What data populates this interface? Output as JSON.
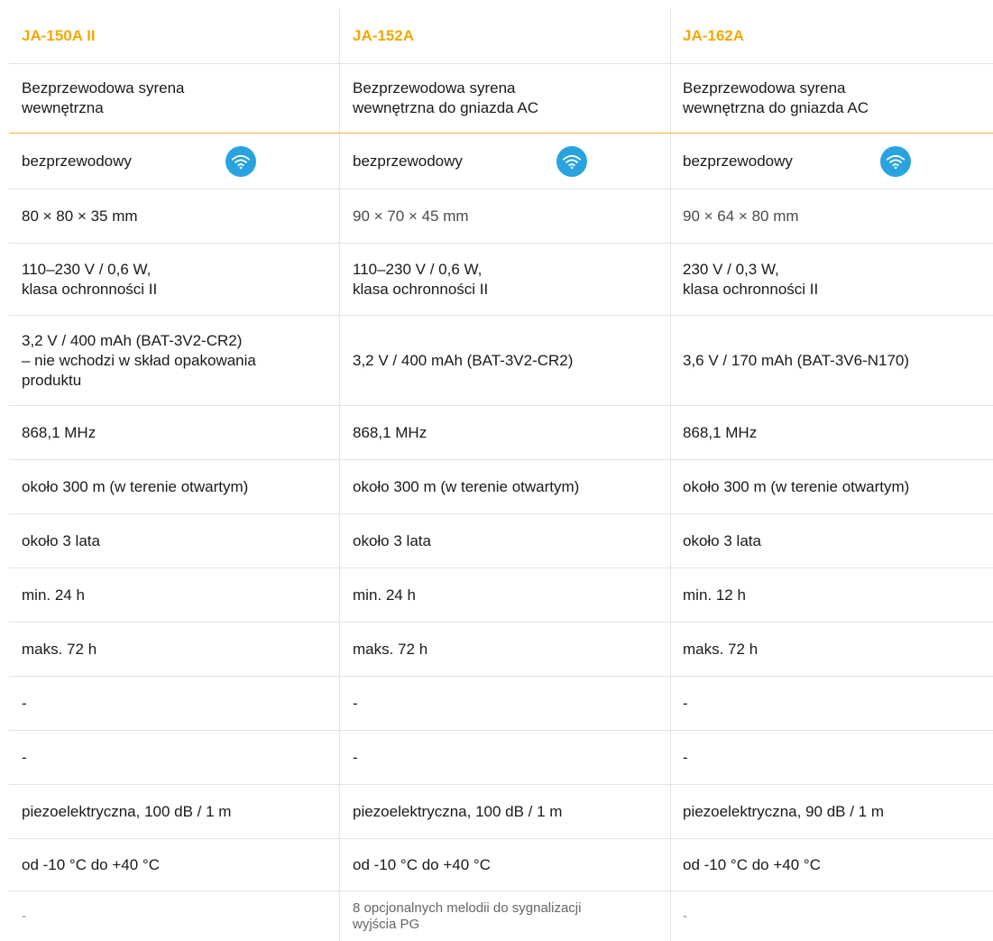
{
  "columns": [
    {
      "model": "JA-150A II",
      "description": "Bezprzewodowa syrena\nwewnętrzna",
      "connection": "bezprzewodowy",
      "dimensions": "80 × 80 × 35 mm",
      "power": "110–230 V / 0,6 W,\nklasa ochronności II",
      "backup_battery": "3,2 V / 400 mAh (BAT-3V2-CR2)\n– nie wchodzi w skład opakowania\nproduktu",
      "frequency": "868,1 MHz",
      "range": "około 300 m (w terenie otwartym)",
      "battery_life": "około 3 lata",
      "backup_min": "min. 24 h",
      "backup_max": "maks. 72 h",
      "row11": "-",
      "row12": "-",
      "siren": "piezoelektryczna, 100 dB / 1 m",
      "temperature": "od -10 °C do +40 °C",
      "melodies": "-"
    },
    {
      "model": "JA-152A",
      "description": "Bezprzewodowa syrena\nwewnętrzna  do gniazda AC",
      "connection": "bezprzewodowy",
      "dimensions": "90 × 70 × 45 mm",
      "power": "110–230 V / 0,6 W,\nklasa ochronności II",
      "backup_battery": "3,2 V / 400 mAh (BAT-3V2-CR2)",
      "frequency": "868,1 MHz",
      "range": "około 300 m (w terenie otwartym)",
      "battery_life": "około 3 lata",
      "backup_min": "min. 24 h",
      "backup_max": "maks. 72 h",
      "row11": "-",
      "row12": "-",
      "siren": "piezoelektryczna, 100 dB / 1 m",
      "temperature": "od -10 °C do +40 °C",
      "melodies": "8 opcjonalnych melodii do sygnalizacji\nwyjścia PG"
    },
    {
      "model": "JA-162A",
      "description": "Bezprzewodowa syrena\nwewnętrzna do gniazda AC",
      "connection": "bezprzewodowy",
      "dimensions": "90 × 64 × 80 mm",
      "power": "230 V / 0,3 W,\nklasa ochronności II",
      "backup_battery": "3,6 V / 170 mAh (BAT-3V6-N170)",
      "frequency": "868,1 MHz",
      "range": "około 300 m (w terenie otwartym)",
      "battery_life": "około 3 lata",
      "backup_min": "min. 12 h",
      "backup_max": "maks. 72 h",
      "row11": "-",
      "row12": "-",
      "siren": "piezoelektryczna, 90 dB / 1 m",
      "temperature": "od -10 °C do +40 °C",
      "melodies": "-"
    }
  ],
  "icons": {
    "wireless": "wifi-icon"
  },
  "colors": {
    "accent": "#f2a900",
    "wifi_badge": "#29a3e0",
    "divider": "#e3e3e3"
  }
}
